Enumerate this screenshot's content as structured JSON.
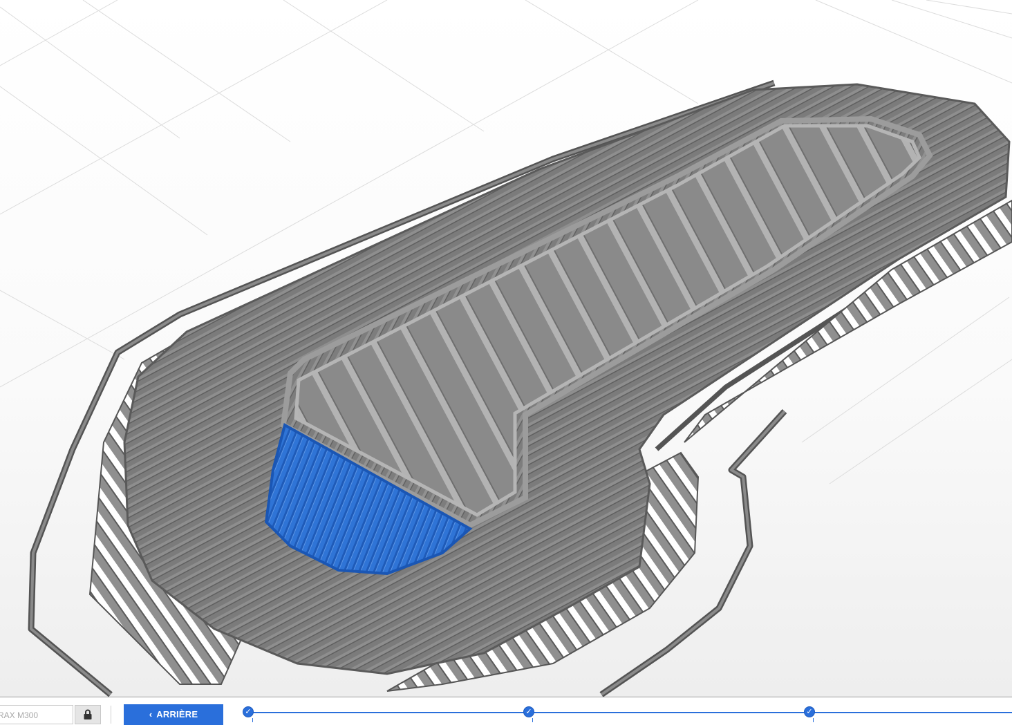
{
  "viewport": {
    "description_icon": "sliced-toolpath-preview"
  },
  "bottom_bar": {
    "printer_field": {
      "value": "RAX M300"
    },
    "lock_icon": "lock-icon",
    "back_button": {
      "chevron": "‹",
      "label": "ARRIÈRE"
    },
    "steps": [
      {
        "icon": "check-icon",
        "glyph": "✓",
        "state": "completed"
      },
      {
        "icon": "check-icon",
        "glyph": "✓",
        "state": "completed"
      },
      {
        "icon": "check-icon",
        "glyph": "✓",
        "state": "completed"
      }
    ]
  },
  "colors": {
    "accent": "#2a6fdb",
    "toolpath_gray": "#7a7a7a",
    "selected_layer_blue": "#2d72d2",
    "grid": "#dcdcdc"
  }
}
